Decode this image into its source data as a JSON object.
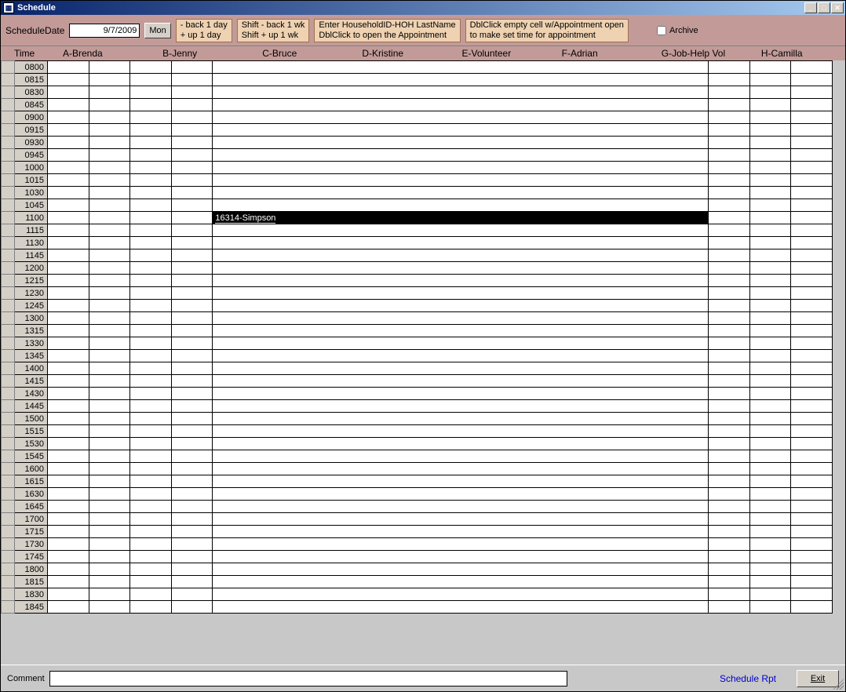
{
  "window": {
    "title": "Schedule"
  },
  "toolbar": {
    "date_label": "ScheduleDate",
    "date_value": "9/7/2009",
    "day_btn": "Mon",
    "hint1_line1": "- back 1 day",
    "hint1_line2": "+ up 1 day",
    "hint2_line1": "Shift - back 1 wk",
    "hint2_line2": "Shift + up 1 wk",
    "hint3_line1": "Enter HouseholdID-HOH LastName",
    "hint3_line2": "DblClick to open the Appointment",
    "hint4_line1": "DblClick empty cell w/Appointment open",
    "hint4_line2": "to make set time for appointment",
    "archive_label": "Archive"
  },
  "columns": {
    "time": "Time",
    "c0": "A-Brenda",
    "c1": "B-Jenny",
    "c2": "C-Bruce",
    "c3": "D-Kristine",
    "c4": "E-Volunteer",
    "c5": "F-Adrian",
    "c6": "G-Job-Help Vol",
    "c7": "H-Camilla"
  },
  "times": [
    "0800",
    "0815",
    "0830",
    "0845",
    "0900",
    "0915",
    "0930",
    "0945",
    "1000",
    "1015",
    "1030",
    "1045",
    "1100",
    "1115",
    "1130",
    "1145",
    "1200",
    "1215",
    "1230",
    "1245",
    "1300",
    "1315",
    "1330",
    "1345",
    "1400",
    "1415",
    "1430",
    "1445",
    "1500",
    "1515",
    "1530",
    "1545",
    "1600",
    "1615",
    "1630",
    "1645",
    "1700",
    "1715",
    "1730",
    "1745",
    "1800",
    "1815",
    "1830",
    "1845"
  ],
  "appointments": {
    "r12c4": "16314-Simpson"
  },
  "footer": {
    "comment_label": "Comment",
    "comment_value": "",
    "schedule_rpt": "Schedule Rpt",
    "exit": "Exit"
  }
}
